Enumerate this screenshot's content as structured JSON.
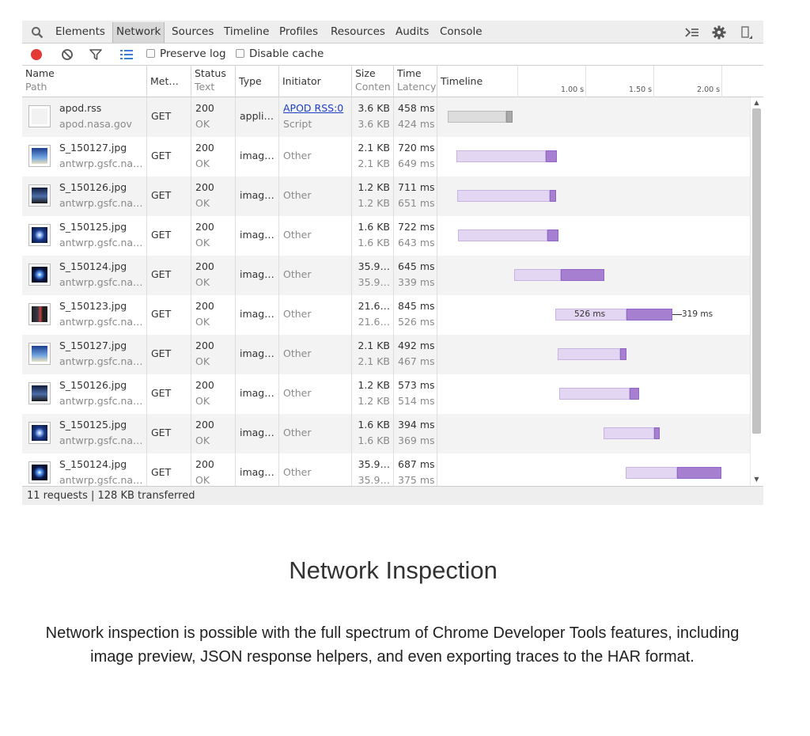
{
  "tabs": [
    "Elements",
    "Network",
    "Sources",
    "Timeline",
    "Profiles",
    "Resources",
    "Audits",
    "Console"
  ],
  "active_tab": "Network",
  "toolbar": {
    "preserve_log_label": "Preserve log",
    "disable_cache_label": "Disable cache",
    "preserve_log_checked": false,
    "disable_cache_checked": false
  },
  "columns": {
    "name": "Name",
    "path": "Path",
    "method": "Met…",
    "status": "Status",
    "status_text": "Text",
    "type": "Type",
    "initiator": "Initiator",
    "size": "Size",
    "content": "Conten",
    "time": "Time",
    "latency": "Latency",
    "timeline": "Timeline"
  },
  "timeline_ticks": [
    "1.00 s",
    "1.50 s",
    "2.00 s"
  ],
  "requests": [
    {
      "name": "apod.rss",
      "path": "apod.nasa.gov",
      "method": "GET",
      "status": "200",
      "status_text": "OK",
      "type": "appli…",
      "initiator": "APOD RSS:0",
      "initiator_sub": "Script",
      "initiator_link": true,
      "size": "3.6 KB",
      "content": "3.6 KB",
      "time": "458 ms",
      "latency": "424 ms",
      "thumb": "blank"
    },
    {
      "name": "S_150127.jpg",
      "path": "antwrp.gsfc.na…",
      "method": "GET",
      "status": "200",
      "status_text": "OK",
      "type": "imag…",
      "initiator": "Other",
      "initiator_sub": "",
      "initiator_link": false,
      "size": "2.1 KB",
      "content": "2.1 KB",
      "time": "720 ms",
      "latency": "649 ms",
      "thumb": "sky"
    },
    {
      "name": "S_150126.jpg",
      "path": "antwrp.gsfc.na…",
      "method": "GET",
      "status": "200",
      "status_text": "OK",
      "type": "imag…",
      "initiator": "Other",
      "initiator_sub": "",
      "initiator_link": false,
      "size": "1.2 KB",
      "content": "1.2 KB",
      "time": "711 ms",
      "latency": "651 ms",
      "thumb": "dusk"
    },
    {
      "name": "S_150125.jpg",
      "path": "antwrp.gsfc.na…",
      "method": "GET",
      "status": "200",
      "status_text": "OK",
      "type": "imag…",
      "initiator": "Other",
      "initiator_sub": "",
      "initiator_link": false,
      "size": "1.6 KB",
      "content": "1.6 KB",
      "time": "722 ms",
      "latency": "643 ms",
      "thumb": "galaxy"
    },
    {
      "name": "S_150124.jpg",
      "path": "antwrp.gsfc.na…",
      "method": "GET",
      "status": "200",
      "status_text": "OK",
      "type": "imag…",
      "initiator": "Other",
      "initiator_sub": "",
      "initiator_link": false,
      "size": "35.9…",
      "content": "35.9…",
      "time": "645 ms",
      "latency": "339 ms",
      "thumb": "nebula"
    },
    {
      "name": "S_150123.jpg",
      "path": "antwrp.gsfc.na…",
      "method": "GET",
      "status": "200",
      "status_text": "OK",
      "type": "imag…",
      "initiator": "Other",
      "initiator_sub": "",
      "initiator_link": false,
      "size": "21.6…",
      "content": "21.6…",
      "time": "845 ms",
      "latency": "526 ms",
      "thumb": "dark"
    },
    {
      "name": "S_150127.jpg",
      "path": "antwrp.gsfc.na…",
      "method": "GET",
      "status": "200",
      "status_text": "OK",
      "type": "imag…",
      "initiator": "Other",
      "initiator_sub": "",
      "initiator_link": false,
      "size": "2.1 KB",
      "content": "2.1 KB",
      "time": "492 ms",
      "latency": "467 ms",
      "thumb": "sky"
    },
    {
      "name": "S_150126.jpg",
      "path": "antwrp.gsfc.na…",
      "method": "GET",
      "status": "200",
      "status_text": "OK",
      "type": "imag…",
      "initiator": "Other",
      "initiator_sub": "",
      "initiator_link": false,
      "size": "1.2 KB",
      "content": "1.2 KB",
      "time": "573 ms",
      "latency": "514 ms",
      "thumb": "dusk"
    },
    {
      "name": "S_150125.jpg",
      "path": "antwrp.gsfc.na…",
      "method": "GET",
      "status": "200",
      "status_text": "OK",
      "type": "imag…",
      "initiator": "Other",
      "initiator_sub": "",
      "initiator_link": false,
      "size": "1.6 KB",
      "content": "1.6 KB",
      "time": "394 ms",
      "latency": "369 ms",
      "thumb": "galaxy"
    },
    {
      "name": "S_150124.jpg",
      "path": "antwrp.gsfc.na…",
      "method": "GET",
      "status": "200",
      "status_text": "OK",
      "type": "imag…",
      "initiator": "Other",
      "initiator_sub": "",
      "initiator_link": false,
      "size": "35.9…",
      "content": "35.9…",
      "time": "687 ms",
      "latency": "375 ms",
      "thumb": "nebula"
    }
  ],
  "timeline_labels": {
    "waiting": "526 ms",
    "receiving": "319 ms"
  },
  "status_bar": "11 requests  |  128 KB transferred",
  "colors": {
    "waiting": "#e3d6f2",
    "receiving": "#a67fd1",
    "record": "#e53935",
    "link": "#1a3fc9"
  },
  "caption": {
    "title": "Network Inspection",
    "text": "Network inspection is possible with the full spectrum of Chrome Developer Tools features, including image preview, JSON response helpers, and even exporting traces to the HAR format."
  }
}
